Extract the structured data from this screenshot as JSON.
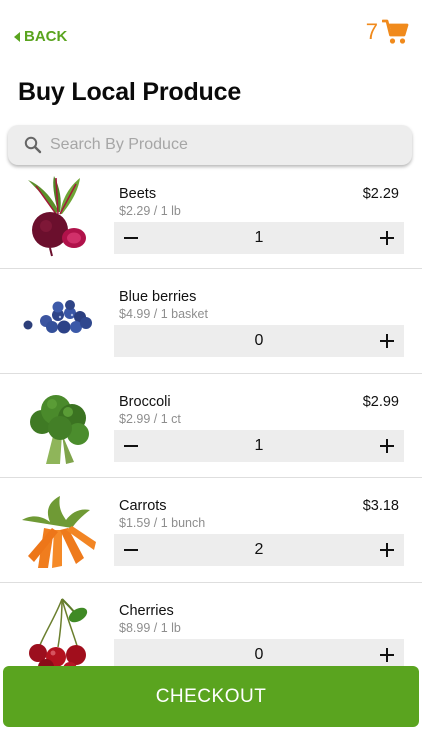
{
  "header": {
    "back_label": "BACK",
    "cart_count": "7",
    "cart_icon": "shopping-cart-icon",
    "back_icon": "caret-left-icon",
    "accent_color": "#5aa41f",
    "cart_color": "#f08a1c"
  },
  "page_title": "Buy Local Produce",
  "search": {
    "placeholder": "Search By Produce",
    "value": "",
    "icon": "search-icon"
  },
  "products": [
    {
      "name": "Beets",
      "unit": "$2.29 / 1 lb",
      "total": "$2.29",
      "quantity": "1",
      "image": "beets-image"
    },
    {
      "name": "Blue berries",
      "unit": "$4.99 / 1 basket",
      "total": "",
      "quantity": "0",
      "image": "blueberries-image"
    },
    {
      "name": "Broccoli",
      "unit": "$2.99 / 1 ct",
      "total": "$2.99",
      "quantity": "1",
      "image": "broccoli-image"
    },
    {
      "name": "Carrots",
      "unit": "$1.59 / 1 bunch",
      "total": "$3.18",
      "quantity": "2",
      "image": "carrots-image"
    },
    {
      "name": "Cherries",
      "unit": "$8.99 / 1 lb",
      "total": "",
      "quantity": "0",
      "image": "cherries-image"
    }
  ],
  "checkout_label": "CHECKOUT"
}
